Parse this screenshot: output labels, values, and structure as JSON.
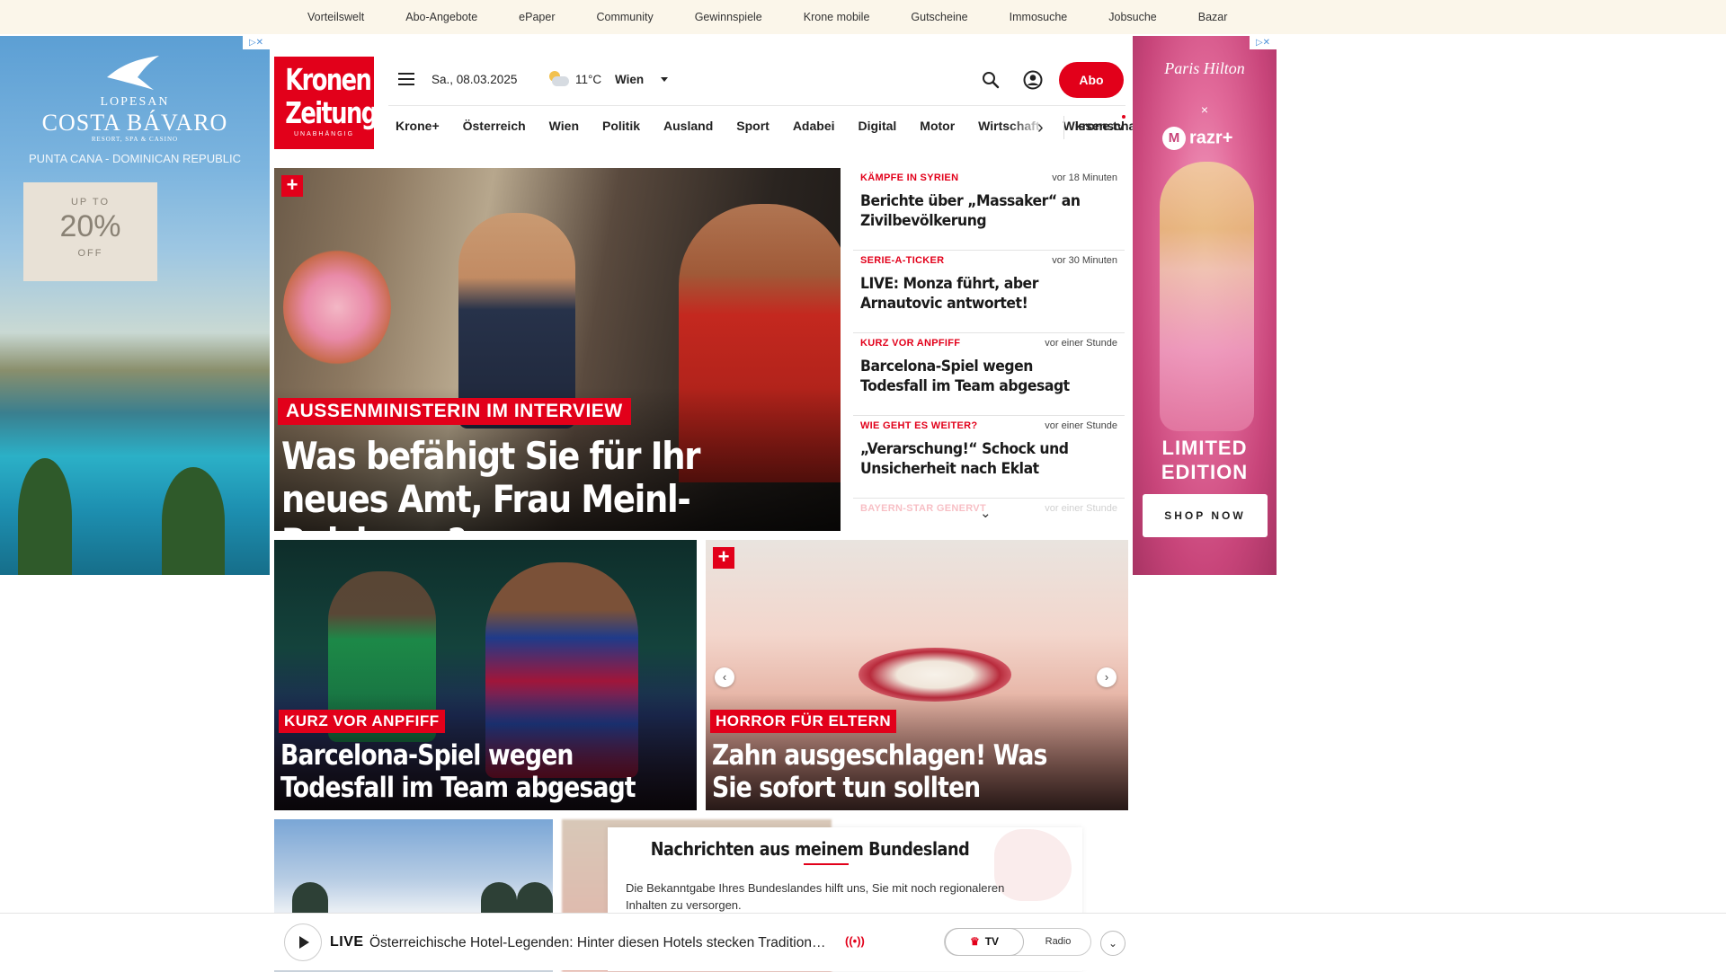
{
  "topbar": {
    "links": [
      "Vorteilswelt",
      "Abo-Angebote",
      "ePaper",
      "Community",
      "Gewinnspiele",
      "Krone mobile",
      "Gutscheine",
      "Immosuche",
      "Jobsuche",
      "Bazar"
    ]
  },
  "ad_left": {
    "brand_top": "LOPESAN",
    "brand_main": "COSTA BÁVARO",
    "brand_sub": "RESORT, SPA & CASINO",
    "location": "PUNTA CANA - DOMINICAN REPUBLIC",
    "offer_top": "UP TO",
    "offer_value": "20%",
    "offer_bottom": "OFF"
  },
  "ad_right": {
    "brand": "Paris Hilton",
    "x": "×",
    "partner": "razr+",
    "headline_1": "LIMITED",
    "headline_2": "EDITION",
    "cta": "SHOP NOW"
  },
  "adchoices_label": "▷✕",
  "logo": {
    "line1": "Kronen",
    "line2": "Zeitung",
    "tagline": "UNABHÄNGIG"
  },
  "header": {
    "date": "Sa., 08.03.2025",
    "temperature": "11°C",
    "city": "Wien",
    "abo_label": "Abo"
  },
  "nav": {
    "items": [
      "Krone+",
      "Österreich",
      "Wien",
      "Politik",
      "Ausland",
      "Sport",
      "Adabei",
      "Digital",
      "Motor",
      "Wirtschaft",
      "Wissenschaft"
    ],
    "more_arrow": "›",
    "kronetv": "krone.tv"
  },
  "hero": {
    "plus": "+",
    "kicker": "AUSSENMINISTERIN IM INTERVIEW",
    "headline": "Was befähigt Sie für Ihr neues Amt, Frau Meinl-Reisinger?"
  },
  "ticker": {
    "items": [
      {
        "category": "KÄMPFE IN SYRIEN",
        "time": "vor 18 Minuten",
        "title": "Berichte über „Massaker“ an Zivilbevölkerung"
      },
      {
        "category": "SERIE-A-TICKER",
        "time": "vor 30 Minuten",
        "title": "LIVE: Monza führt, aber Arnautovic antwortet!"
      },
      {
        "category": "KURZ VOR ANPFIFF",
        "time": "vor einer Stunde",
        "title": "Barcelona-Spiel wegen Todesfall im Team abgesagt"
      },
      {
        "category": "WIE GEHT ES WEITER?",
        "time": "vor einer Stunde",
        "title": "„Verarschung!“ Schock und Unsicherheit nach Eklat"
      },
      {
        "category": "BAYERN-STAR GENERVT",
        "time": "vor einer Stunde",
        "title": ""
      }
    ],
    "expand": "⌄"
  },
  "teasers": [
    {
      "kicker": "KURZ VOR ANPFIFF",
      "headline": "Barcelona-Spiel wegen Todesfall im Team abgesagt"
    },
    {
      "plus": "+",
      "kicker": "HORROR FÜR ELTERN",
      "headline": "Zahn ausgeschlagen! Was Sie sofort tun sollten",
      "prev": "‹",
      "next": "›"
    }
  ],
  "bundesland": {
    "title": "Nachrichten aus meinem Bundesland",
    "text": "Die Bekanntgabe Ihres Bundeslandes hilft uns, Sie mit noch regionaleren Inhalten zu versorgen."
  },
  "player": {
    "live": "LIVE",
    "title": "Österreichische Hotel-Legenden: Hinter diesen Hotels stecken Tradition…",
    "radio_waves": "((•))",
    "tv_label": "TV",
    "radio_label": "Radio",
    "crown": "♛",
    "expand": "⌄"
  },
  "colors": {
    "brand_red": "#e2001a",
    "topbar_bg": "#fbf6ea"
  }
}
